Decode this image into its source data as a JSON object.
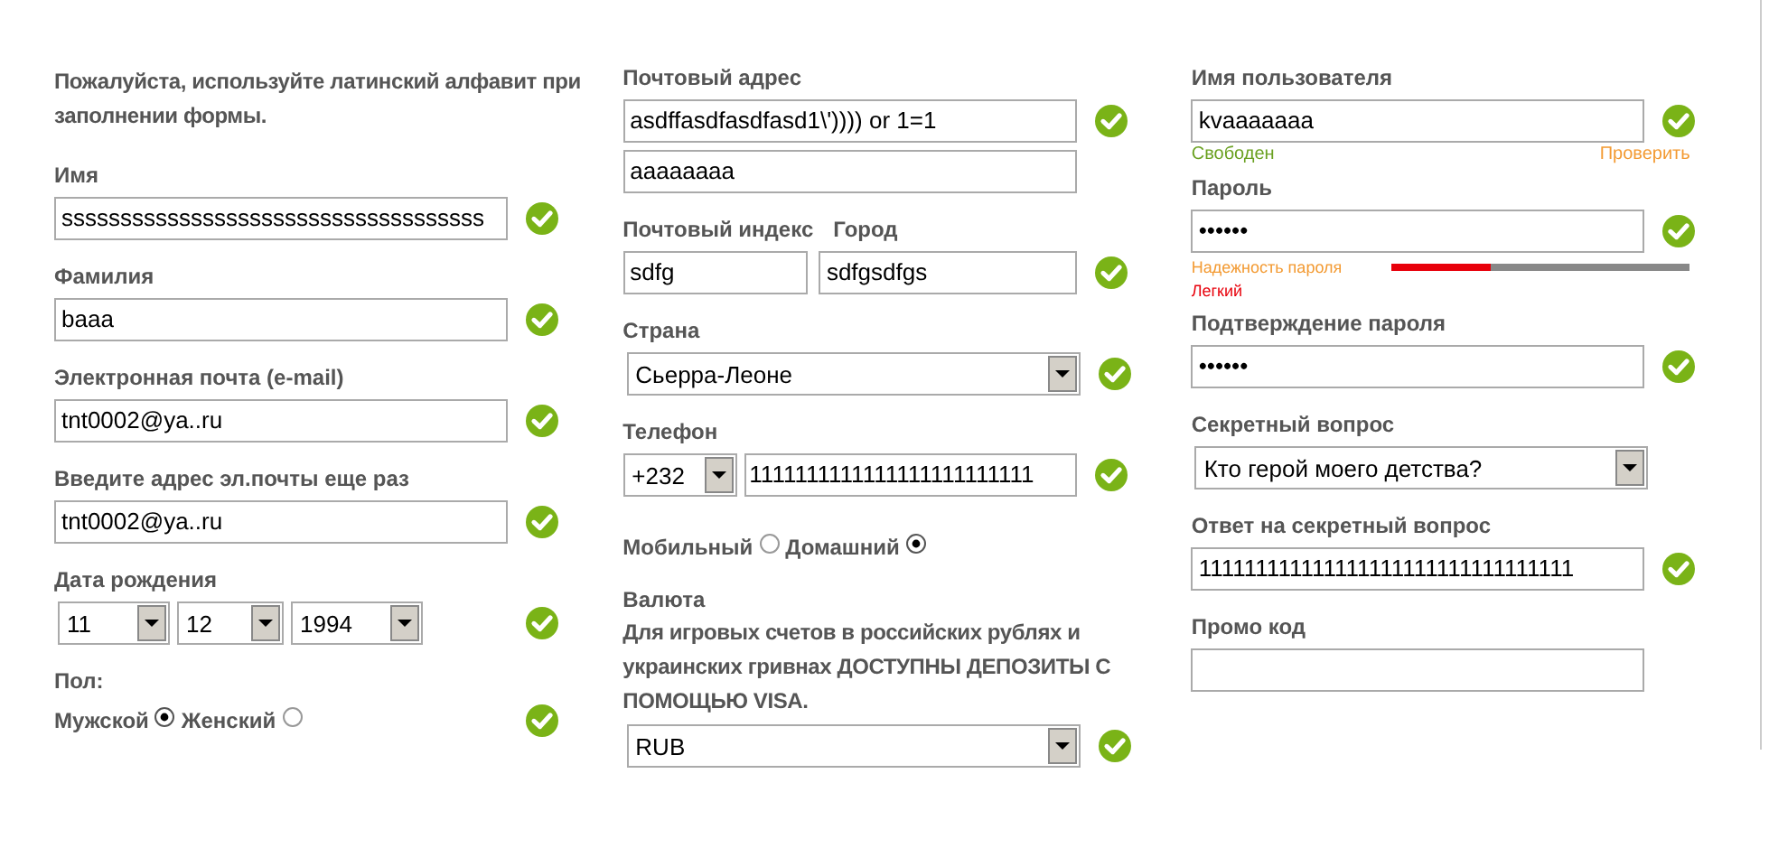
{
  "columns": [
    {
      "rows": [
        {
          "kind": "note",
          "text": "Пожалуйста, используйте латинский алфавит при заполнении формы."
        },
        {
          "kind": "stack",
          "label": "Имя",
          "controls": [
            {
              "kind": "input",
              "value": "ssssssssssssssssssssssssssssssssssss"
            }
          ],
          "valid": true
        },
        {
          "kind": "stack",
          "label": "Фамилия",
          "controls": [
            {
              "kind": "input",
              "value": "baaa"
            }
          ],
          "valid": true
        },
        {
          "kind": "stack",
          "label": "Электронная почта (e-mail)",
          "controls": [
            {
              "kind": "input",
              "value": "tnt0002@ya..ru"
            }
          ],
          "valid": true
        },
        {
          "kind": "stack",
          "label": "Введите адрес эл.почты еще раз",
          "controls": [
            {
              "kind": "input",
              "value": "tnt0002@ya..ru"
            }
          ],
          "valid": true
        },
        {
          "kind": "date",
          "label": "Дата рождения",
          "controls": [
            {
              "kind": "select",
              "value": "11"
            },
            {
              "kind": "select",
              "value": "12"
            },
            {
              "kind": "select",
              "value": "1994"
            }
          ],
          "valid": true
        },
        {
          "kind": "radios",
          "label": "Пол:",
          "controls": [
            {
              "kind": "radio",
              "label": "Мужской",
              "selected": true
            },
            {
              "kind": "radio",
              "label": "Женский",
              "selected": false
            }
          ],
          "valid": true
        }
      ]
    },
    {
      "rows": [
        {
          "kind": "stack",
          "label": "Почтовый адрес",
          "controls": [
            {
              "kind": "input",
              "value": "asdffasdfasdfasd1\\')))) or 1=1"
            },
            {
              "kind": "input",
              "value": "aaaaaaaa"
            }
          ],
          "valid": true
        },
        {
          "kind": "pair",
          "labels": [
            "Почтовый индекс",
            "Город"
          ],
          "controls": [
            {
              "kind": "input",
              "value": "sdfg"
            },
            {
              "kind": "input",
              "value": "sdfgsdfgs"
            }
          ],
          "valid": true
        },
        {
          "kind": "stack",
          "label": "Страна",
          "controls": [
            {
              "kind": "select",
              "value": "Сьерра-Леоне"
            }
          ],
          "valid": true
        },
        {
          "kind": "phone",
          "label": "Телефон",
          "controls": [
            {
              "kind": "select",
              "value": "+232"
            },
            {
              "kind": "input",
              "value": "1111111111111111111111111"
            }
          ],
          "valid": true
        },
        {
          "kind": "radios",
          "controls": [
            {
              "kind": "radio",
              "label": "Мобильный",
              "selected": false
            },
            {
              "kind": "radio",
              "label": "Домашний",
              "selected": true
            }
          ],
          "valid": false
        },
        {
          "kind": "stack",
          "label": "Валюта",
          "note": "Для игровых счетов в российских рублях и украинских гривнах ДОСТУПНЫ ДЕПОЗИТЫ С ПОМОЩЬЮ VISA.",
          "controls": [
            {
              "kind": "select",
              "value": "RUB"
            }
          ],
          "valid": true
        }
      ]
    },
    {
      "rows": [
        {
          "kind": "username",
          "label": "Имя пользователя",
          "controls": [
            {
              "kind": "input",
              "value": "kvaaaaaaa"
            }
          ],
          "valid": true,
          "status": "Свободен",
          "check_link": "Проверить"
        },
        {
          "kind": "password",
          "label": "Пароль",
          "controls": [
            {
              "kind": "input",
              "value": "••••••"
            }
          ],
          "valid": true,
          "strength": {
            "label": "Надежность пароля",
            "level": 0.33,
            "text": "Легкий"
          }
        },
        {
          "kind": "stack",
          "label": "Подтверждение пароля",
          "controls": [
            {
              "kind": "input",
              "value": "••••••"
            }
          ],
          "valid": true
        },
        {
          "kind": "stack",
          "label": "Секретный вопрос",
          "controls": [
            {
              "kind": "select",
              "value": "Кто герой моего детства?"
            }
          ],
          "valid": false
        },
        {
          "kind": "stack",
          "label": "Ответ на секретный вопрос",
          "controls": [
            {
              "kind": "input",
              "value": "111111111111111111111111111111111"
            }
          ],
          "valid": true
        },
        {
          "kind": "stack",
          "label": "Промо код",
          "controls": [
            {
              "kind": "input"
            }
          ],
          "valid": false
        }
      ]
    }
  ]
}
